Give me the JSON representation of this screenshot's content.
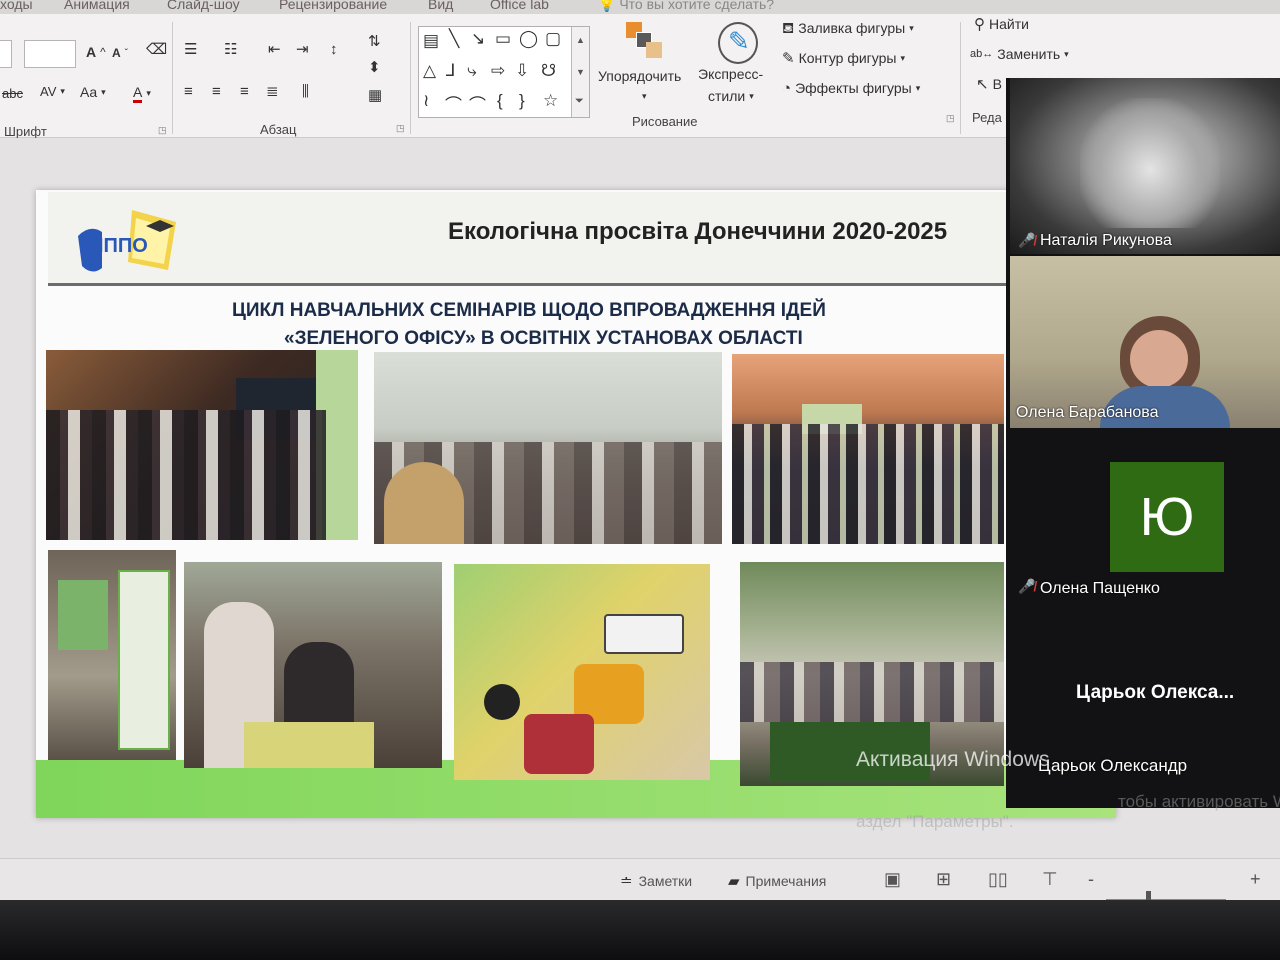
{
  "tabs": [
    {
      "label": "ходы"
    },
    {
      "label": "Анимация"
    },
    {
      "label": "Слайд-шоу"
    },
    {
      "label": "Рецензирование"
    },
    {
      "label": "Вид"
    },
    {
      "label": "Office lab"
    },
    {
      "label": "Что вы хотите сделать?"
    }
  ],
  "ribbon": {
    "font_group": "Шрифт",
    "paragraph_group": "Абзац",
    "drawing_group": "Рисование",
    "edit_group": "Реда",
    "arrange": "Упорядочить",
    "express_styles_1": "Экспресс-",
    "express_styles_2": "стили",
    "shape_fill": "Заливка фигуры",
    "shape_outline": "Контур фигуры",
    "shape_effects": "Эффекты фигуры",
    "find": "Найти",
    "replace": "Заменить",
    "select_short": "В",
    "font_size_up": "A",
    "font_size_down": "A",
    "abc": "abc",
    "spacing": "AV",
    "case": "Aa",
    "font_color": "A"
  },
  "slide": {
    "logo_text": "ІППО",
    "title": "Екологічна просвіта Донеччини 2020-2025",
    "subtitle_line1": "ЦИКЛ НАВЧАЛЬНИХ СЕМІНАРІВ ЩОДО ВПРОВАДЖЕННЯ ІДЕЙ",
    "subtitle_line2": "«ЗЕЛЕНОГО ОФІСУ» В ОСВІТНІХ УСТАНОВАХ ОБЛАСТІ"
  },
  "participants": [
    {
      "name": "Наталія Рикунова",
      "muted": true
    },
    {
      "name": "Олена Барабанова",
      "muted": false
    },
    {
      "name": "Олена Пащенко",
      "muted": true,
      "initial": "Ю"
    }
  ],
  "active_speaker": "Царьок  Олекса...",
  "caption_name": "Царьок Олександр",
  "watermark": {
    "line1": "Активация Windows",
    "line2": "тобы активировать Windows, перейдите в",
    "line3": "аздел \"Параметры\"."
  },
  "statusbar": {
    "notes": "Заметки",
    "comments": "Примечания",
    "zoom_minus": "-",
    "zoom_plus": "+"
  },
  "colors": {
    "slide_green": "#8fdc64",
    "avatar_bg": "#2e6b12",
    "muted_icon": "#e23b3b"
  }
}
